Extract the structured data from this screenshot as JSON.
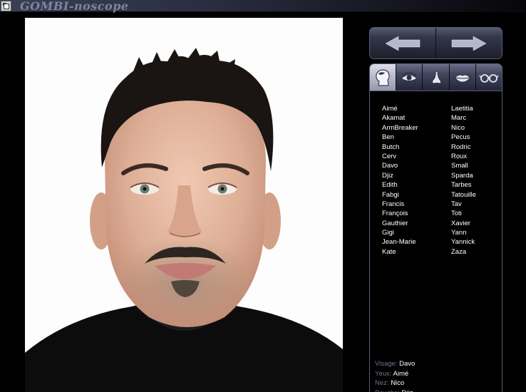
{
  "window": {
    "title": "GOMBI-noscope"
  },
  "nav": {
    "prev_icon": "arrow-left-icon",
    "next_icon": "arrow-right-icon"
  },
  "tabs": [
    {
      "name": "visage",
      "icon": "head-icon",
      "active": true
    },
    {
      "name": "yeux",
      "icon": "eye-icon",
      "active": false
    },
    {
      "name": "nez",
      "icon": "nose-icon",
      "active": false
    },
    {
      "name": "bouche",
      "icon": "mouth-icon",
      "active": false
    },
    {
      "name": "lunettes",
      "icon": "glasses-icon",
      "active": false
    }
  ],
  "names": [
    "Aimé",
    "Akamat",
    "ArmBreaker",
    "Ben",
    "Butch",
    "Cerv",
    "Davo",
    "Djiz",
    "Edith",
    "Fabgi",
    "Francis",
    "François",
    "Gauthier",
    "Gigi",
    "Jean-Marie",
    "Kate",
    "Laetitia",
    "Marc",
    "Nico",
    "Pecus",
    "Rodric",
    "Roux",
    "Small",
    "Sparda",
    "Tarbes",
    "Tatouille",
    "Tav",
    "Toti",
    "Xavier",
    "Yann",
    "Yannick",
    "Zaza"
  ],
  "status": [
    {
      "label": "Visage:",
      "value": "Davo"
    },
    {
      "label": "Yeux:",
      "value": "Aimé"
    },
    {
      "label": "Nez:",
      "value": "Nico"
    },
    {
      "label": "Bouche:",
      "value": "Djiz"
    }
  ],
  "colors": {
    "accent": "#5b5f78",
    "label": "#6e7391",
    "background": "#000000"
  }
}
